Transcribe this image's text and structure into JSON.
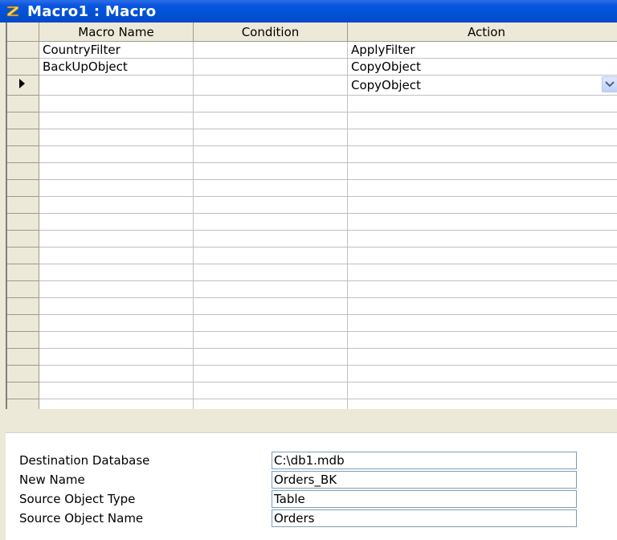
{
  "window": {
    "title": "Macro1 : Macro"
  },
  "grid": {
    "columns": [
      "Macro Name",
      "Condition",
      "Action"
    ],
    "rows": [
      {
        "name": "CountryFilter",
        "condition": "",
        "action": "ApplyFilter",
        "current": false
      },
      {
        "name": "BackUpObject",
        "condition": "",
        "action": "CopyObject",
        "current": false
      },
      {
        "name": "",
        "condition": "",
        "action": "CopyObject",
        "current": true
      },
      {
        "name": "",
        "condition": "",
        "action": "",
        "current": false
      },
      {
        "name": "",
        "condition": "",
        "action": "",
        "current": false
      },
      {
        "name": "",
        "condition": "",
        "action": "",
        "current": false
      },
      {
        "name": "",
        "condition": "",
        "action": "",
        "current": false
      },
      {
        "name": "",
        "condition": "",
        "action": "",
        "current": false
      },
      {
        "name": "",
        "condition": "",
        "action": "",
        "current": false
      },
      {
        "name": "",
        "condition": "",
        "action": "",
        "current": false
      },
      {
        "name": "",
        "condition": "",
        "action": "",
        "current": false
      },
      {
        "name": "",
        "condition": "",
        "action": "",
        "current": false
      },
      {
        "name": "",
        "condition": "",
        "action": "",
        "current": false
      },
      {
        "name": "",
        "condition": "",
        "action": "",
        "current": false
      },
      {
        "name": "",
        "condition": "",
        "action": "",
        "current": false
      },
      {
        "name": "",
        "condition": "",
        "action": "",
        "current": false
      },
      {
        "name": "",
        "condition": "",
        "action": "",
        "current": false
      },
      {
        "name": "",
        "condition": "",
        "action": "",
        "current": false
      },
      {
        "name": "",
        "condition": "",
        "action": "",
        "current": false
      },
      {
        "name": "",
        "condition": "",
        "action": "",
        "current": false
      },
      {
        "name": "",
        "condition": "",
        "action": "",
        "current": false
      },
      {
        "name": "",
        "condition": "",
        "action": "",
        "current": false
      }
    ]
  },
  "action_arguments": [
    {
      "label": "Destination Database",
      "value": "C:\\db1.mdb"
    },
    {
      "label": "New Name",
      "value": "Orders_BK"
    },
    {
      "label": "Source Object Type",
      "value": "Table"
    },
    {
      "label": "Source Object Name",
      "value": "Orders"
    }
  ],
  "icons": {
    "app": "access-macro-icon",
    "current_row": "record-pointer-icon",
    "dropdown": "chevron-down-icon"
  },
  "colors": {
    "title_bar": "#0a55e0",
    "window_face": "#ece9d8",
    "grid_lines": "#c0c0c0",
    "field_border": "#7f9db9"
  }
}
